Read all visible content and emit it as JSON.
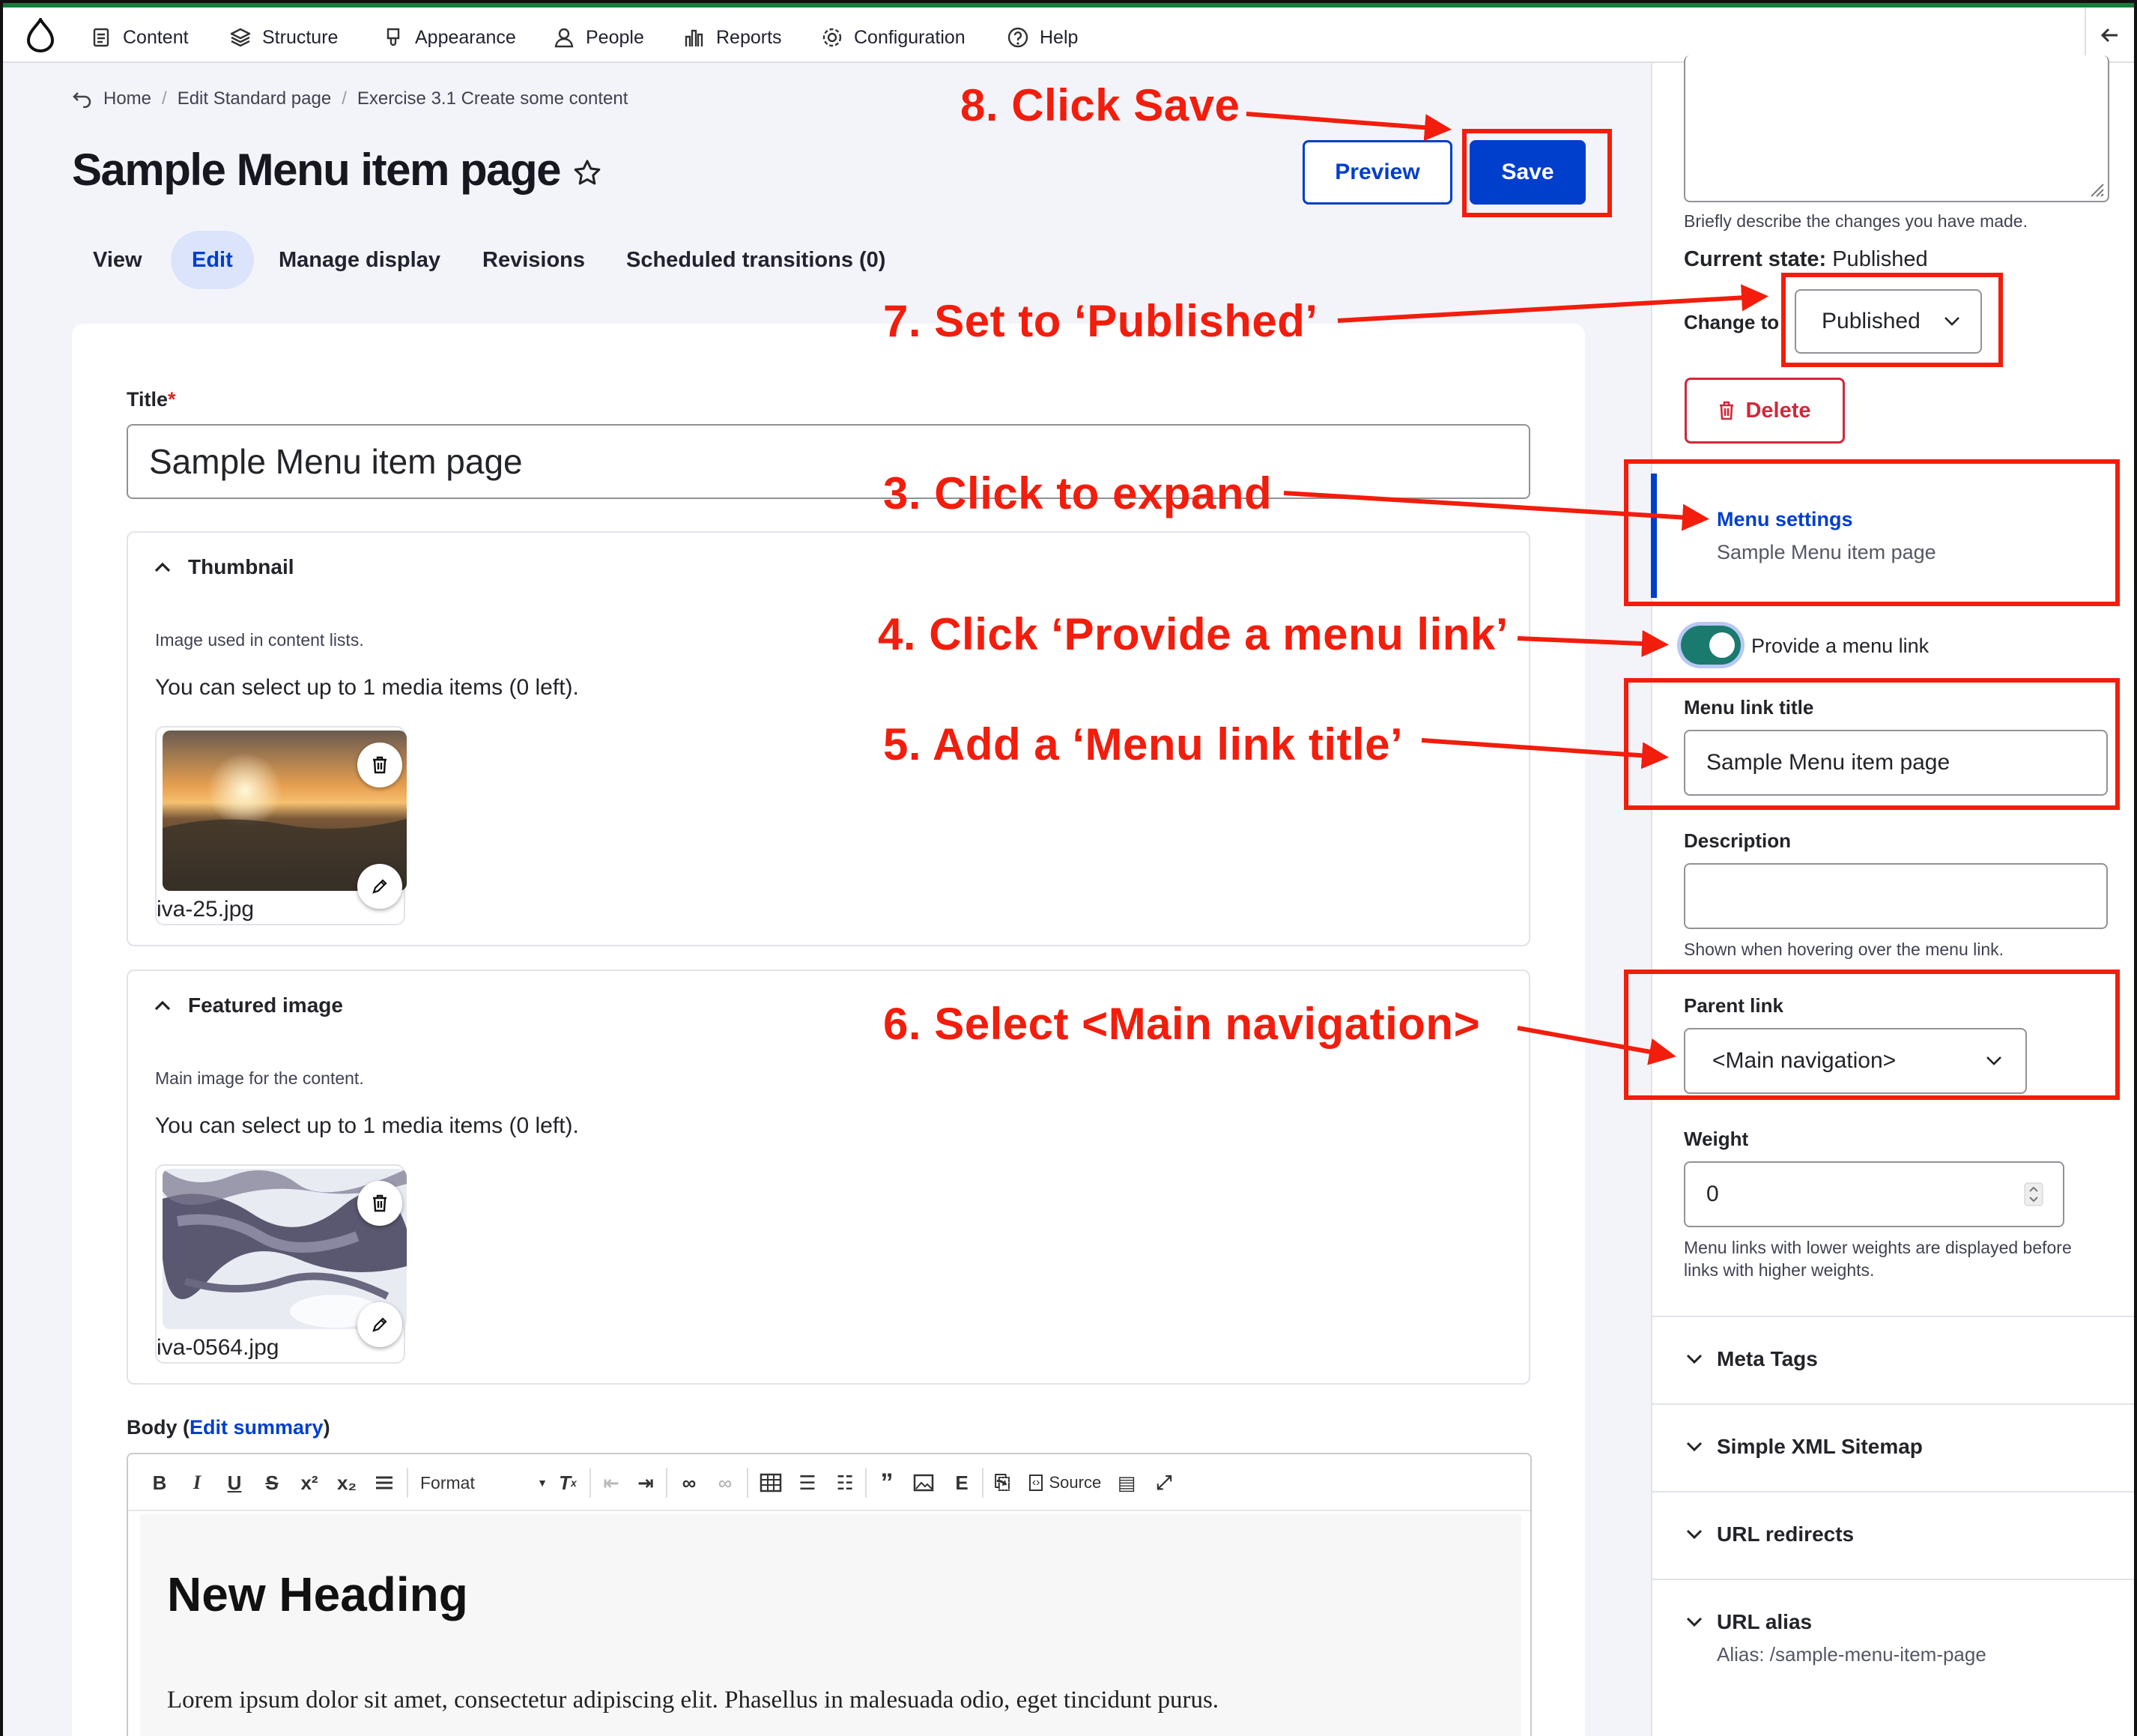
{
  "toolbar": {
    "items": [
      {
        "label": "Content",
        "icon": "document-icon"
      },
      {
        "label": "Structure",
        "icon": "layers-icon"
      },
      {
        "label": "Appearance",
        "icon": "brush-icon"
      },
      {
        "label": "People",
        "icon": "person-icon"
      },
      {
        "label": "Reports",
        "icon": "bar-chart-icon"
      },
      {
        "label": "Configuration",
        "icon": "gear-icon"
      },
      {
        "label": "Help",
        "icon": "question-icon"
      }
    ]
  },
  "breadcrumb": {
    "items": [
      "Home",
      "Edit Standard page",
      "Exercise 3.1 Create some content"
    ]
  },
  "page": {
    "title": "Sample Menu item page"
  },
  "actions": {
    "preview": "Preview",
    "save": "Save"
  },
  "tabs": [
    "View",
    "Edit",
    "Manage display",
    "Revisions",
    "Scheduled transitions (0)"
  ],
  "form": {
    "title_label": "Title",
    "required_mark": "*",
    "title_value": "Sample Menu item page",
    "thumbnail": {
      "heading": "Thumbnail",
      "description": "Image used in content lists.",
      "count_text": "You can select up to 1 media items (0 left).",
      "file_name": "iva-25.jpg"
    },
    "featured": {
      "heading": "Featured image",
      "description": "Main image for the content.",
      "count_text": "You can select up to 1 media items (0 left).",
      "file_name": "iva-0564.jpg"
    },
    "body": {
      "label_prefix": "Body (",
      "edit_summary": "Edit summary",
      "label_suffix": ")",
      "format_label": "Format",
      "source_label": "Source",
      "heading": "New Heading",
      "paragraph": "Lorem ipsum dolor sit amet, consectetur adipiscing elit. Phasellus in malesuada odio, eget tincidunt purus."
    }
  },
  "sidebar": {
    "revision_help": "Briefly describe the changes you have made.",
    "current_state_label": "Current state:",
    "current_state_value": "Published",
    "change_to_label": "Change to",
    "change_to_value": "Published",
    "delete_label": "Delete",
    "menu_settings": {
      "title": "Menu settings",
      "summary": "Sample Menu item page"
    },
    "provide_menu_link": "Provide a menu link",
    "provide_menu_link_checked": true,
    "menu_link_title_label": "Menu link title",
    "menu_link_title_value": "Sample Menu item page",
    "description_label": "Description",
    "description_value": "",
    "description_help": "Shown when hovering over the menu link.",
    "parent_link_label": "Parent link",
    "parent_link_value": "<Main navigation>",
    "weight_label": "Weight",
    "weight_value": "0",
    "weight_help_1": "Menu links with lower weights are displayed before",
    "weight_help_2": "links with higher weights.",
    "sections": [
      {
        "title": "Meta Tags"
      },
      {
        "title": "Simple XML Sitemap"
      },
      {
        "title": "URL redirects"
      },
      {
        "title": "URL alias",
        "summary": "Alias: /sample-menu-item-page"
      }
    ]
  },
  "annotations": {
    "step3": "3. Click to expand",
    "step4": "4. Click ‘Provide a menu link’",
    "step5": "5. Add a ‘Menu link title’",
    "step6": "6. Select <Main navigation>",
    "step7": "7. Set to ‘Published’",
    "step8": "8. Click Save"
  },
  "colors": {
    "accent": "#003ecc",
    "annotation": "#f21d0c",
    "danger": "#d2283a",
    "toggle": "#1a7a6e"
  }
}
